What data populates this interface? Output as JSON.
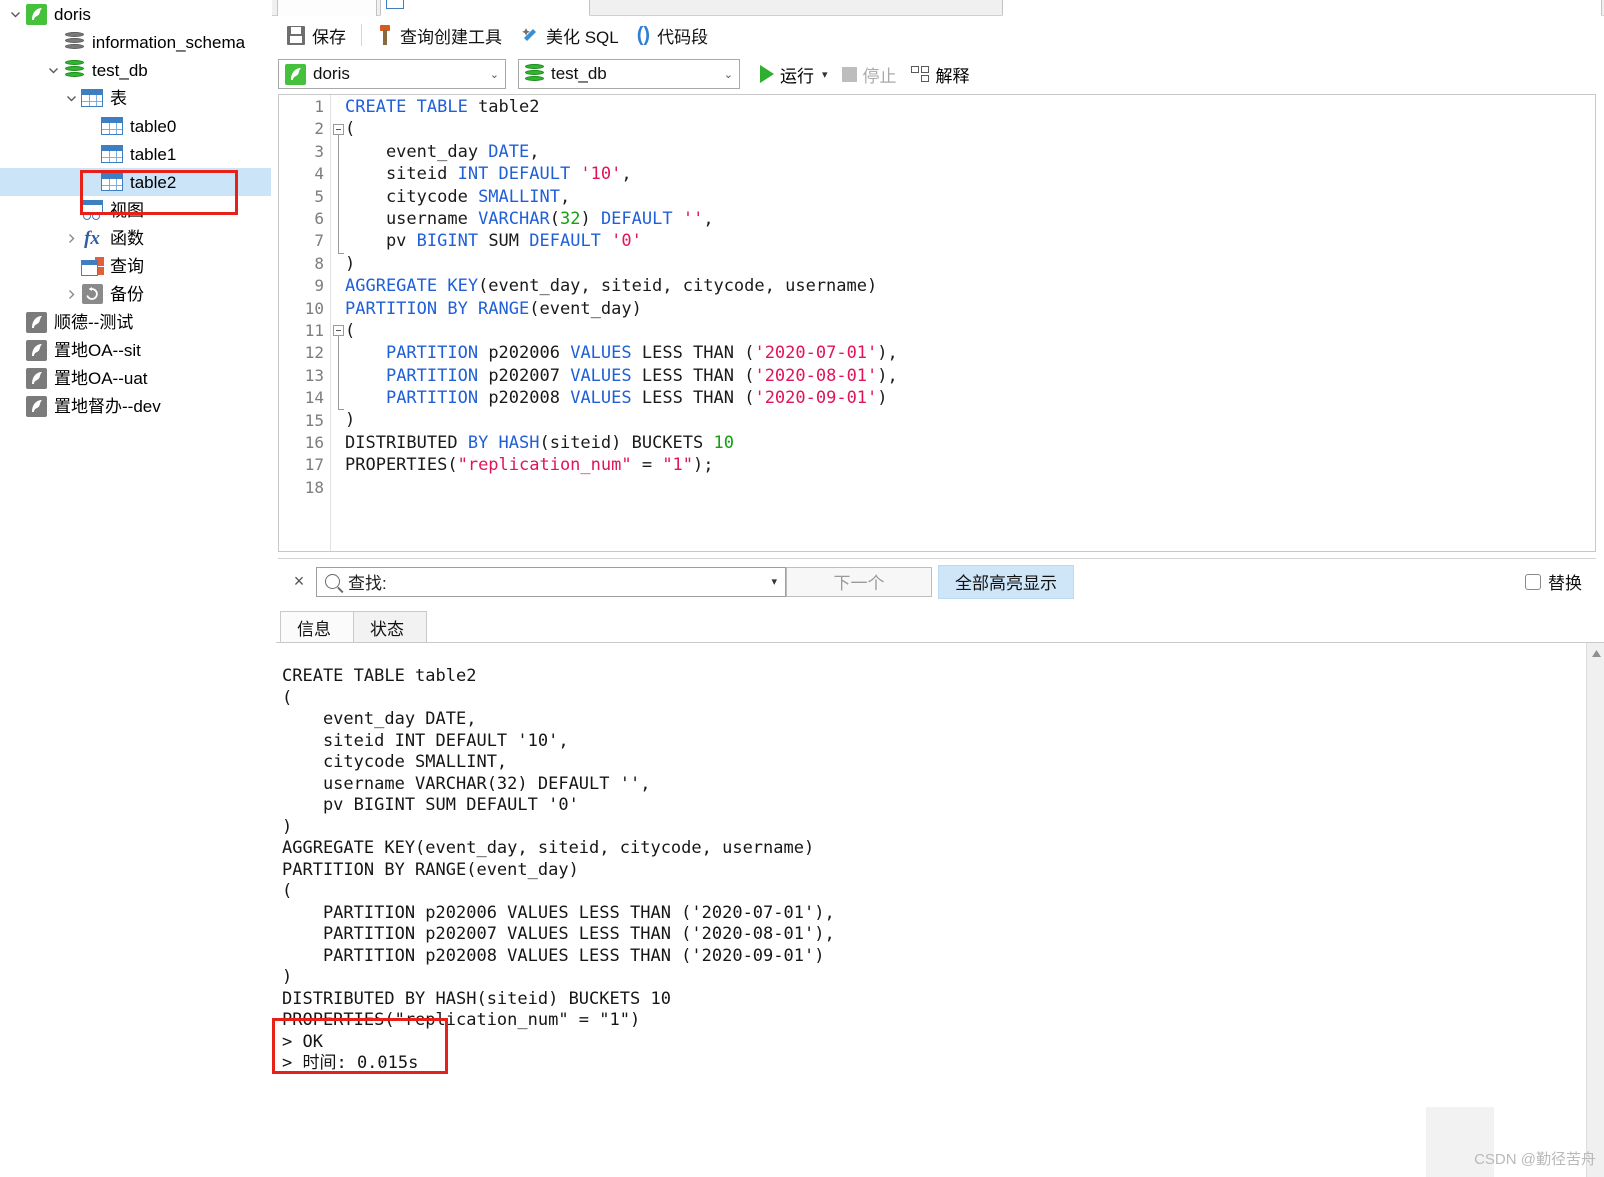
{
  "window": {
    "tab_label": ""
  },
  "sidebar": {
    "items": [
      {
        "label": "doris",
        "icon": "connection-icon",
        "icon_color": "#45c13b",
        "indent": 6,
        "twisty": "down",
        "depth": 0,
        "type": "connection",
        "selected": false
      },
      {
        "label": "information_schema",
        "icon": "database-icon",
        "icon_color": "#7a7a7a",
        "indent": 44,
        "twisty": "none",
        "depth": 1,
        "type": "database",
        "selected": false
      },
      {
        "label": "test_db",
        "icon": "database-icon",
        "icon_color": "#2eb82e",
        "indent": 44,
        "twisty": "down",
        "depth": 1,
        "type": "database",
        "selected": false
      },
      {
        "label": "表",
        "icon": "table-folder-icon",
        "icon_color": "#3d7fc1",
        "indent": 62,
        "twisty": "down",
        "depth": 2,
        "type": "table-folder",
        "selected": false
      },
      {
        "label": "table0",
        "icon": "table-icon",
        "icon_color": "#3d7fc1",
        "indent": 82,
        "twisty": "none",
        "depth": 3,
        "type": "table",
        "selected": false
      },
      {
        "label": "table1",
        "icon": "table-icon",
        "icon_color": "#3d7fc1",
        "indent": 82,
        "twisty": "none",
        "depth": 3,
        "type": "table",
        "selected": false
      },
      {
        "label": "table2",
        "icon": "table-icon",
        "icon_color": "#3d7fc1",
        "indent": 82,
        "twisty": "none",
        "depth": 3,
        "type": "table",
        "selected": true
      },
      {
        "label": "视图",
        "icon": "view-icon",
        "icon_color": "#3d7fc1",
        "indent": 62,
        "twisty": "none",
        "depth": 2,
        "type": "view-folder",
        "selected": false
      },
      {
        "label": "函数",
        "icon": "function-icon",
        "icon_color": "#2f5fa0",
        "indent": 62,
        "twisty": "right",
        "depth": 2,
        "type": "function-folder",
        "selected": false
      },
      {
        "label": "查询",
        "icon": "query-icon",
        "icon_color": "#e0603c",
        "indent": 62,
        "twisty": "none",
        "depth": 2,
        "type": "query-folder",
        "selected": false
      },
      {
        "label": "备份",
        "icon": "backup-icon",
        "icon_color": "#8a8a8a",
        "indent": 62,
        "twisty": "right",
        "depth": 2,
        "type": "backup-folder",
        "selected": false
      },
      {
        "label": "顺德--测试",
        "icon": "connection-icon",
        "icon_color": "#7b7b7b",
        "indent": 6,
        "twisty": "none",
        "depth": 0,
        "type": "connection",
        "selected": false
      },
      {
        "label": "置地OA--sit",
        "icon": "connection-icon",
        "icon_color": "#7b7b7b",
        "indent": 6,
        "twisty": "none",
        "depth": 0,
        "type": "connection",
        "selected": false
      },
      {
        "label": "置地OA--uat",
        "icon": "connection-icon",
        "icon_color": "#7b7b7b",
        "indent": 6,
        "twisty": "none",
        "depth": 0,
        "type": "connection",
        "selected": false
      },
      {
        "label": "置地督办--dev",
        "icon": "connection-icon",
        "icon_color": "#7b7b7b",
        "indent": 6,
        "twisty": "none",
        "depth": 0,
        "type": "connection",
        "selected": false
      }
    ],
    "annotation_color": "#e8201a"
  },
  "toolbar": {
    "save_label": "保存",
    "query_builder_label": "查询创建工具",
    "beautify_sql_label": "美化 SQL",
    "snippet_label": "代码段",
    "connection_value": "doris",
    "database_value": "test_db",
    "run_label": "运行",
    "stop_label": "停止",
    "explain_label": "解释"
  },
  "editor": {
    "line_count": 18,
    "lines": [
      {
        "num": 1,
        "tokens": [
          {
            "t": "CREATE TABLE ",
            "c": "k"
          },
          {
            "t": "table2",
            "c": "p"
          }
        ]
      },
      {
        "num": 2,
        "tokens": [
          {
            "t": "(",
            "c": "p"
          }
        ]
      },
      {
        "num": 3,
        "tokens": [
          {
            "t": "    event_day ",
            "c": "p"
          },
          {
            "t": "DATE",
            "c": "k"
          },
          {
            "t": ",",
            "c": "p"
          }
        ]
      },
      {
        "num": 4,
        "tokens": [
          {
            "t": "    siteid ",
            "c": "p"
          },
          {
            "t": "INT DEFAULT ",
            "c": "k"
          },
          {
            "t": "'10'",
            "c": "s"
          },
          {
            "t": ",",
            "c": "p"
          }
        ]
      },
      {
        "num": 5,
        "tokens": [
          {
            "t": "    citycode ",
            "c": "p"
          },
          {
            "t": "SMALLINT",
            "c": "k"
          },
          {
            "t": ",",
            "c": "p"
          }
        ]
      },
      {
        "num": 6,
        "tokens": [
          {
            "t": "    username ",
            "c": "p"
          },
          {
            "t": "VARCHAR",
            "c": "k"
          },
          {
            "t": "(",
            "c": "p"
          },
          {
            "t": "32",
            "c": "n"
          },
          {
            "t": ") ",
            "c": "p"
          },
          {
            "t": "DEFAULT ",
            "c": "k"
          },
          {
            "t": "''",
            "c": "s"
          },
          {
            "t": ",",
            "c": "p"
          }
        ]
      },
      {
        "num": 7,
        "tokens": [
          {
            "t": "    pv ",
            "c": "p"
          },
          {
            "t": "BIGINT",
            "c": "k"
          },
          {
            "t": " SUM ",
            "c": "p"
          },
          {
            "t": "DEFAULT ",
            "c": "k"
          },
          {
            "t": "'0'",
            "c": "s"
          }
        ]
      },
      {
        "num": 8,
        "tokens": [
          {
            "t": ")",
            "c": "p"
          }
        ]
      },
      {
        "num": 9,
        "tokens": [
          {
            "t": "AGGREGATE KEY",
            "c": "k"
          },
          {
            "t": "(event_day, siteid, citycode, username)",
            "c": "p"
          }
        ]
      },
      {
        "num": 10,
        "tokens": [
          {
            "t": "PARTITION BY RANGE",
            "c": "k"
          },
          {
            "t": "(event_day)",
            "c": "p"
          }
        ]
      },
      {
        "num": 11,
        "tokens": [
          {
            "t": "(",
            "c": "p"
          }
        ]
      },
      {
        "num": 12,
        "tokens": [
          {
            "t": "    ",
            "c": "p"
          },
          {
            "t": "PARTITION",
            "c": "k"
          },
          {
            "t": " p202006 ",
            "c": "p"
          },
          {
            "t": "VALUES",
            "c": "k"
          },
          {
            "t": " LESS THAN (",
            "c": "p"
          },
          {
            "t": "'2020-07-01'",
            "c": "s"
          },
          {
            "t": "),",
            "c": "p"
          }
        ]
      },
      {
        "num": 13,
        "tokens": [
          {
            "t": "    ",
            "c": "p"
          },
          {
            "t": "PARTITION",
            "c": "k"
          },
          {
            "t": " p202007 ",
            "c": "p"
          },
          {
            "t": "VALUES",
            "c": "k"
          },
          {
            "t": " LESS THAN (",
            "c": "p"
          },
          {
            "t": "'2020-08-01'",
            "c": "s"
          },
          {
            "t": "),",
            "c": "p"
          }
        ]
      },
      {
        "num": 14,
        "tokens": [
          {
            "t": "    ",
            "c": "p"
          },
          {
            "t": "PARTITION",
            "c": "k"
          },
          {
            "t": " p202008 ",
            "c": "p"
          },
          {
            "t": "VALUES",
            "c": "k"
          },
          {
            "t": " LESS THAN (",
            "c": "p"
          },
          {
            "t": "'2020-09-01'",
            "c": "s"
          },
          {
            "t": ")",
            "c": "p"
          }
        ]
      },
      {
        "num": 15,
        "tokens": [
          {
            "t": ")",
            "c": "p"
          }
        ]
      },
      {
        "num": 16,
        "tokens": [
          {
            "t": "DISTRIBUTED ",
            "c": "p"
          },
          {
            "t": "BY HASH",
            "c": "k"
          },
          {
            "t": "(siteid) BUCKETS ",
            "c": "p"
          },
          {
            "t": "10",
            "c": "n"
          }
        ]
      },
      {
        "num": 17,
        "tokens": [
          {
            "t": "PROPERTIES(",
            "c": "p"
          },
          {
            "t": "\"replication_num\"",
            "c": "s"
          },
          {
            "t": " = ",
            "c": "p"
          },
          {
            "t": "\"1\"",
            "c": "s"
          },
          {
            "t": ");",
            "c": "p"
          }
        ]
      },
      {
        "num": 18,
        "tokens": []
      }
    ]
  },
  "findbar": {
    "close_label": "×",
    "search_placeholder": "查找:",
    "search_value": "",
    "next_label": "下一个",
    "highlight_all_label": "全部高亮显示",
    "replace_label": "替换",
    "replace_checked": false
  },
  "result_tabs": [
    {
      "label": "信息",
      "active": true
    },
    {
      "label": "状态",
      "active": false
    }
  ],
  "output": {
    "text": "CREATE TABLE table2\n(\n    event_day DATE,\n    siteid INT DEFAULT '10',\n    citycode SMALLINT,\n    username VARCHAR(32) DEFAULT '',\n    pv BIGINT SUM DEFAULT '0'\n)\nAGGREGATE KEY(event_day, siteid, citycode, username)\nPARTITION BY RANGE(event_day)\n(\n    PARTITION p202006 VALUES LESS THAN ('2020-07-01'),\n    PARTITION p202007 VALUES LESS THAN ('2020-08-01'),\n    PARTITION p202008 VALUES LESS THAN ('2020-09-01')\n)\nDISTRIBUTED BY HASH(siteid) BUCKETS 10\nPROPERTIES(\"replication_num\" = \"1\")\n> OK\n> 时间: 0.015s",
    "status_ok": "> OK",
    "elapsed": "> 时间: 0.015s",
    "annotation_color": "#e8201a"
  },
  "watermark": {
    "text": "CSDN @勤径苦舟"
  }
}
